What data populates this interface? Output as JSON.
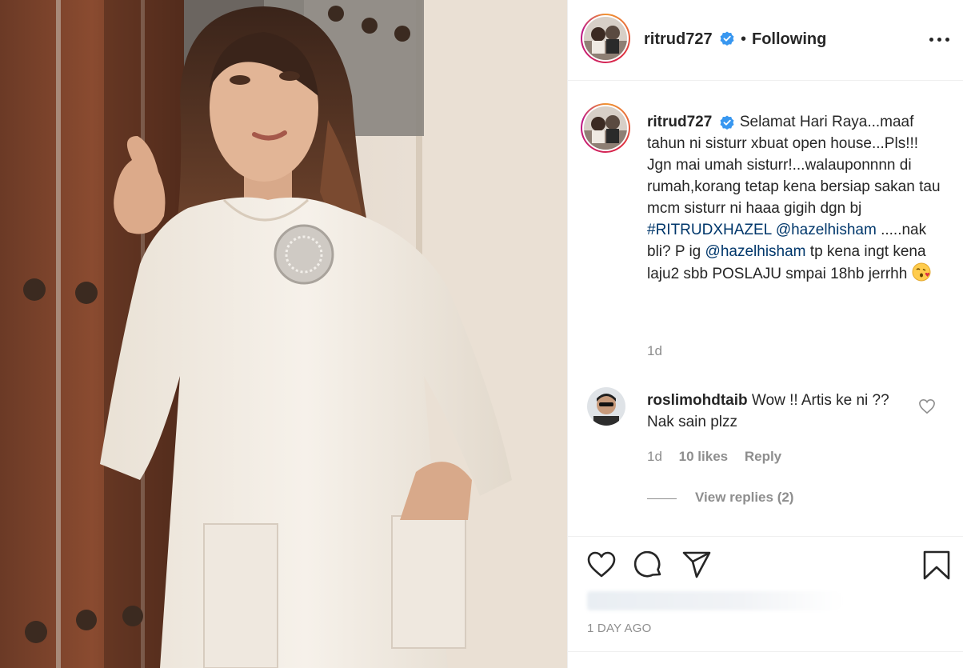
{
  "post": {
    "username": "ritrud727",
    "verified": true,
    "follow_status": "Following",
    "separator": "•",
    "caption": {
      "intro": "Selamat Hari Raya...maaf tahun ni sisturr xbuat open house...Pls!!! Jgn mai umah sisturr!...walauponnnn di rumah,korang tetap kena bersiap sakan tau mcm sisturr ni haaa gigih dgn bj",
      "hashtag": "#RITRUDXHAZEL",
      "mention1": "@hazelhisham",
      "middle": ".....nak bli? P ig",
      "mention2": "@hazelhisham",
      "outro": "tp kena ingt kena laju2 sbb POSLAJU smpai 18hb jerrhh",
      "emoji": "face-blowing-kiss"
    },
    "caption_time": "1d",
    "date_label": "1 DAY AGO"
  },
  "comment": {
    "username": "roslimohdtaib",
    "text": "Wow !! Artis ke ni ?? Nak sain plzz",
    "time": "1d",
    "likes": "10 likes",
    "reply_label": "Reply",
    "view_replies": "View replies (2)"
  },
  "icons": {
    "more": "more-options-icon",
    "like": "heart-icon",
    "comment": "comment-bubble-icon",
    "share": "paper-plane-icon",
    "save": "bookmark-icon",
    "verified": "verified-badge-icon"
  },
  "colors": {
    "link": "#00376b",
    "verified": "#3897f0",
    "muted": "#8e8e8e",
    "text": "#262626",
    "border": "#efefef"
  }
}
